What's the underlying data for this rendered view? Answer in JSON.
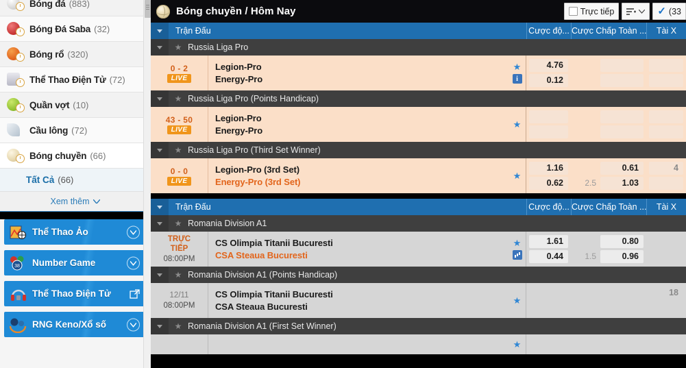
{
  "sidebar": {
    "sports": [
      {
        "label": "Bóng đá",
        "count": "(883)",
        "icon": "soccer-ball-icon",
        "color": "#d8d8d8",
        "clipped": true
      },
      {
        "label": "Bóng Đá Saba",
        "count": "(32)",
        "icon": "soccer-saba-icon",
        "color": "#c94040"
      },
      {
        "label": "Bóng rổ",
        "count": "(320)",
        "icon": "basketball-icon",
        "color": "#e0601c"
      },
      {
        "label": "Thể Thao Điện Tử",
        "count": "(72)",
        "icon": "esports-icon",
        "color": "#b8b8c4"
      },
      {
        "label": "Quần vợt",
        "count": "(10)",
        "icon": "tennis-ball-icon",
        "color": "#9ac93a"
      },
      {
        "label": "Cầu lông",
        "count": "(72)",
        "icon": "badminton-icon",
        "color": "#cfd6dd"
      },
      {
        "label": "Bóng chuyền",
        "count": "(66)",
        "icon": "volleyball-icon",
        "color": "#e8dcb8",
        "active": true
      }
    ],
    "subitem": {
      "label": "Tất Cả",
      "count": "(66)"
    },
    "show_more": "Xem thêm",
    "promos": [
      {
        "label": "Thể Thao Ảo",
        "icon": "virtual-sports-icon",
        "action": "chevron-down-icon"
      },
      {
        "label": "Number Game",
        "icon": "number-game-icon",
        "action": "chevron-down-icon"
      },
      {
        "label": "Thể Thao Điện Tử",
        "icon": "esports-headset-icon",
        "action": "external-link-icon"
      },
      {
        "label": "RNG Keno/Xổ số",
        "icon": "keno-lottery-icon",
        "action": "chevron-down-icon"
      }
    ]
  },
  "header": {
    "title": "Bóng chuyền / Hôm Nay",
    "icon": "volleyball-icon",
    "live_toggle": "Trực tiếp",
    "sort_button": "sort-icon",
    "check_button": "(33"
  },
  "columns": {
    "match": "Trận Đấu",
    "moneyline": "Cược độ...",
    "handicap": "Cược Chấp Toàn ...",
    "overunder": "Tài X"
  },
  "sections": [
    {
      "groups": [
        {
          "title": "Russia Liga Pro",
          "matches": [
            {
              "status": "live",
              "score": "0 - 2",
              "badge": "LIVE",
              "home": "Legion-Pro",
              "away": "Energy-Pro",
              "away_highlight": false,
              "icons": [
                "star-icon",
                "info-icon"
              ],
              "moneyline": [
                "4.76",
                "0.12"
              ],
              "handicap": {
                "values": [
                  "",
                  ""
                ],
                "line": ""
              },
              "overunder": [
                "",
                ""
              ]
            }
          ]
        },
        {
          "title": "Russia Liga Pro (Points Handicap)",
          "matches": [
            {
              "status": "live",
              "score": "43 - 50",
              "badge": "LIVE",
              "home": "Legion-Pro",
              "away": "Energy-Pro",
              "away_highlight": false,
              "icons": [
                "star-icon"
              ],
              "moneyline": [
                "",
                ""
              ],
              "handicap": {
                "values": [
                  "",
                  ""
                ],
                "line": ""
              },
              "overunder": [
                "",
                ""
              ]
            }
          ]
        },
        {
          "title": "Russia Liga Pro (Third Set Winner)",
          "matches": [
            {
              "status": "live",
              "score": "0 - 0",
              "badge": "LIVE",
              "home": "Legion-Pro (3rd Set)",
              "away": "Energy-Pro (3rd Set)",
              "away_highlight": true,
              "icons": [
                "star-icon"
              ],
              "moneyline": [
                "1.16",
                "0.62"
              ],
              "handicap": {
                "values": [
                  "0.61",
                  "1.03"
                ],
                "line": "2.5"
              },
              "overunder": [
                "4",
                ""
              ]
            }
          ]
        }
      ]
    },
    {
      "groups": [
        {
          "title": "Romania Division A1",
          "matches": [
            {
              "status": "soon",
              "live_label_1": "TRỰC",
              "live_label_2": "TIẾP",
              "time": "08:00PM",
              "home": "CS Olimpia Titanii Bucuresti",
              "away": "CSA Steaua Bucuresti",
              "away_highlight": true,
              "icons": [
                "star-icon",
                "stats-icon"
              ],
              "moneyline": [
                "1.61",
                "0.44"
              ],
              "handicap": {
                "values": [
                  "0.80",
                  "0.96"
                ],
                "line": "1.5"
              },
              "overunder": [
                "",
                ""
              ]
            }
          ]
        },
        {
          "title": "Romania Division A1 (Points Handicap)",
          "matches": [
            {
              "status": "scheduled",
              "date": "12/11",
              "time": "08:00PM",
              "home": "CS Olimpia Titanii Bucuresti",
              "away": "CSA Steaua Bucuresti",
              "away_highlight": false,
              "icons": [
                "star-icon"
              ],
              "moneyline": [
                "",
                ""
              ],
              "handicap": {
                "values": [
                  "",
                  ""
                ],
                "line": ""
              },
              "overunder": [
                "18",
                ""
              ]
            }
          ]
        },
        {
          "title": "Romania Division A1 (First Set Winner)",
          "matches": [
            {
              "status": "partial",
              "home": "",
              "away": "",
              "icons": [
                "star-icon"
              ],
              "moneyline": [
                "",
                ""
              ],
              "handicap": {
                "values": [
                  "",
                  ""
                ],
                "line": ""
              },
              "overunder": [
                "",
                ""
              ]
            }
          ]
        }
      ]
    }
  ]
}
